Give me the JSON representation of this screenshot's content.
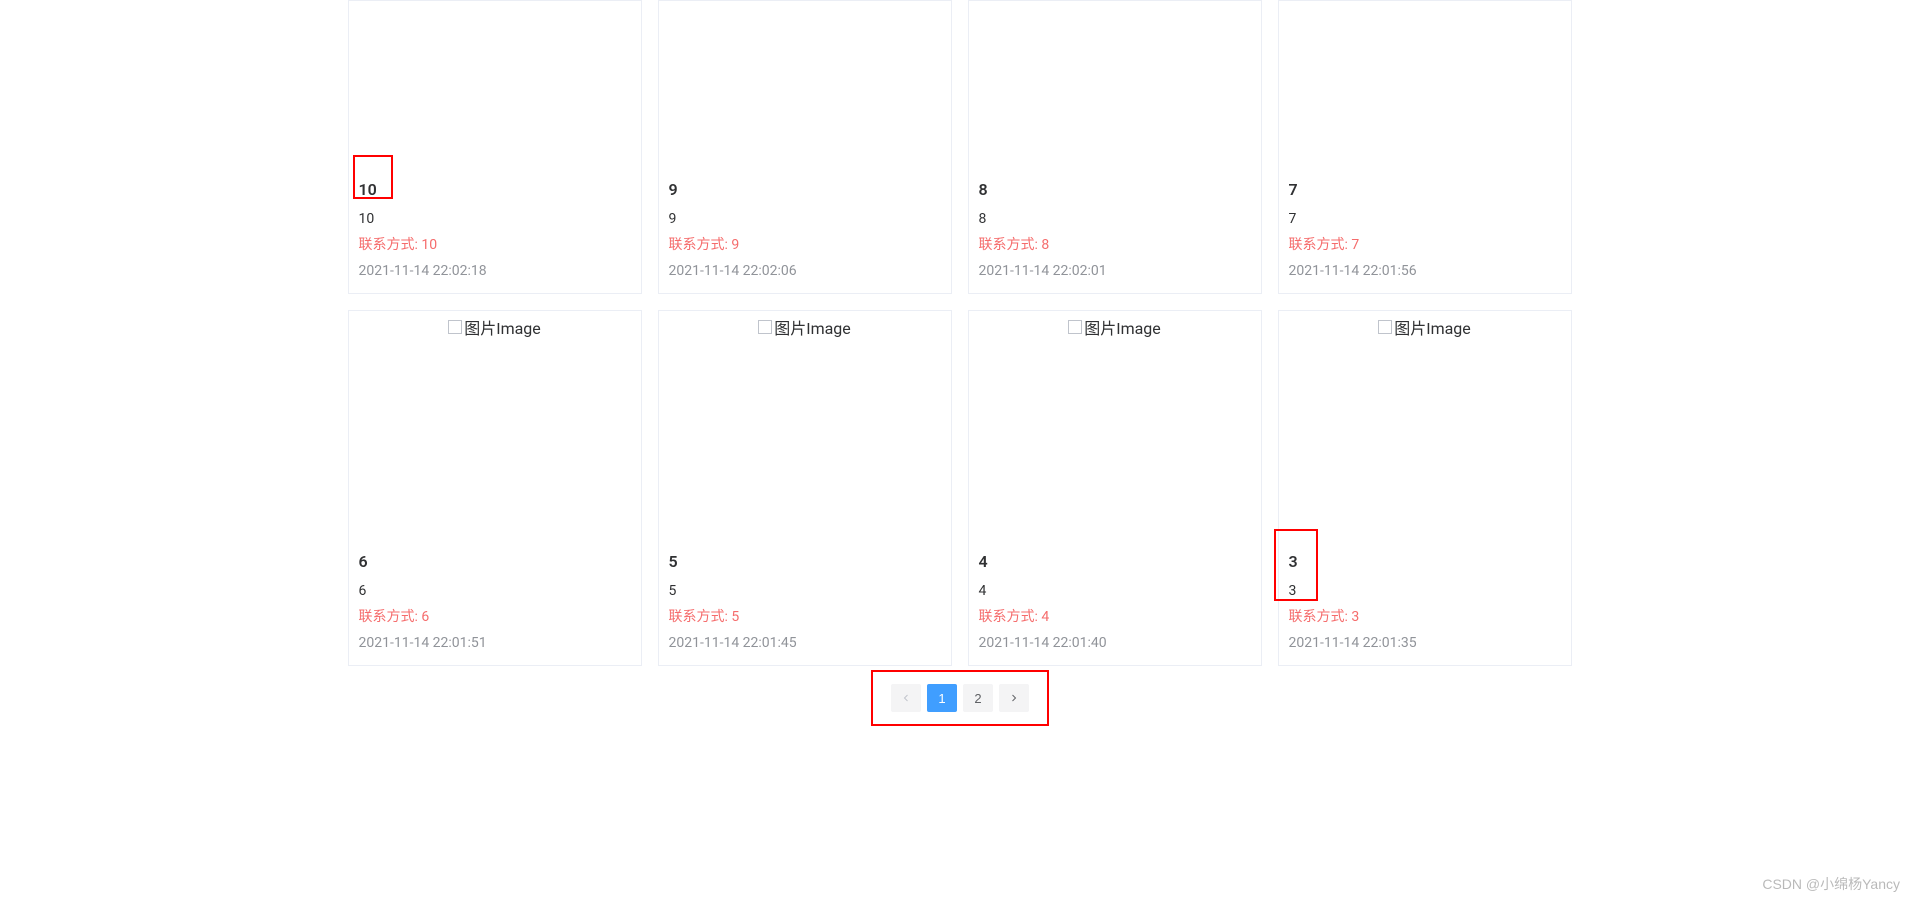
{
  "imagePlaceholderLabel": "图片Image",
  "contactPrefix": "联系方式: ",
  "row1": [
    {
      "title": "10",
      "sub": "10",
      "contact": "10",
      "date": "2021-11-14 22:02:18"
    },
    {
      "title": "9",
      "sub": "9",
      "contact": "9",
      "date": "2021-11-14 22:02:06"
    },
    {
      "title": "8",
      "sub": "8",
      "contact": "8",
      "date": "2021-11-14 22:02:01"
    },
    {
      "title": "7",
      "sub": "7",
      "contact": "7",
      "date": "2021-11-14 22:01:56"
    }
  ],
  "row2": [
    {
      "title": "6",
      "sub": "6",
      "contact": "6",
      "date": "2021-11-14 22:01:51"
    },
    {
      "title": "5",
      "sub": "5",
      "contact": "5",
      "date": "2021-11-14 22:01:45"
    },
    {
      "title": "4",
      "sub": "4",
      "contact": "4",
      "date": "2021-11-14 22:01:40"
    },
    {
      "title": "3",
      "sub": "3",
      "contact": "3",
      "date": "2021-11-14 22:01:35"
    }
  ],
  "pagination": {
    "prev": "‹",
    "pages": [
      {
        "label": "1",
        "active": true
      },
      {
        "label": "2",
        "active": false
      }
    ],
    "next": "›"
  },
  "watermark": "CSDN @小绵杨Yancy"
}
